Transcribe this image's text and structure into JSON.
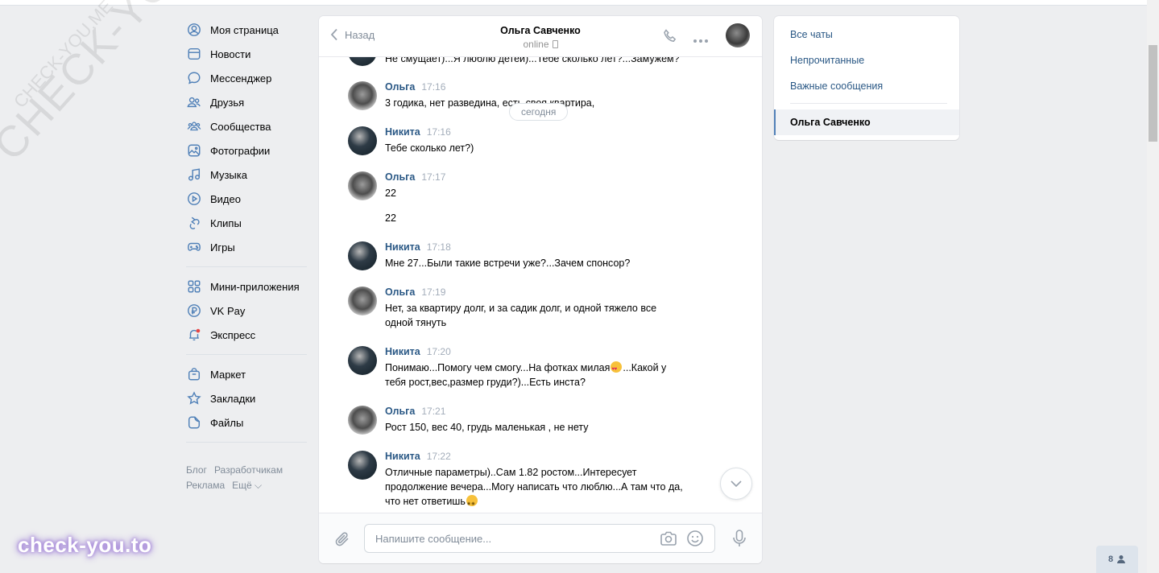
{
  "watermark": {
    "large": "CHECK-YOU.ME",
    "small": "CHECK-YOU.ME",
    "brand": "check-you.to"
  },
  "menu": {
    "items": [
      {
        "label": "Моя страница",
        "icon": "user-circle-icon"
      },
      {
        "label": "Новости",
        "icon": "news-icon"
      },
      {
        "label": "Мессенджер",
        "icon": "chat-bubble-icon"
      },
      {
        "label": "Друзья",
        "icon": "friends-icon"
      },
      {
        "label": "Сообщества",
        "icon": "communities-icon"
      },
      {
        "label": "Фотографии",
        "icon": "photo-icon"
      },
      {
        "label": "Музыка",
        "icon": "music-note-icon"
      },
      {
        "label": "Видео",
        "icon": "play-icon"
      },
      {
        "label": "Клипы",
        "icon": "clips-icon"
      },
      {
        "label": "Игры",
        "icon": "gamepad-icon"
      }
    ],
    "items2": [
      {
        "label": "Мини-приложения",
        "icon": "grid-icon"
      },
      {
        "label": "VK Pay",
        "icon": "ruble-icon"
      },
      {
        "label": "Экспресс",
        "icon": "bell-icon"
      }
    ],
    "items3": [
      {
        "label": "Маркет",
        "icon": "bag-icon"
      },
      {
        "label": "Закладки",
        "icon": "star-icon"
      },
      {
        "label": "Файлы",
        "icon": "file-icon"
      }
    ],
    "footer": [
      "Блог",
      "Разработчикам",
      "Реклама",
      "Ещё ⌵"
    ]
  },
  "chat": {
    "back_label": "Назад",
    "name": "Ольга Савченко",
    "status": "online",
    "date_pill": "сегодня",
    "partial_text": "Не смущает)...Я люблю детей)...Тебе сколько лет?...Замужем?",
    "messages": [
      {
        "author": "Ольга",
        "time": "17:16",
        "text": "3 годика, нет разведина, есть своя квартира,"
      },
      {
        "author": "Никита",
        "time": "17:16",
        "text": "Тебе сколько лет?)"
      },
      {
        "author": "Ольга",
        "time": "17:17",
        "text": "22",
        "text2": "22"
      },
      {
        "author": "Никита",
        "time": "17:18",
        "text": "Мне 27...Были такие встречи уже?...Зачем спонсор?"
      },
      {
        "author": "Ольга",
        "time": "17:19",
        "text": "Нет, за квартиру долг, и за садик долг, и одной тяжело все одной тянуть"
      },
      {
        "author": "Никита",
        "time": "17:20",
        "text_a": "Понимаю...Помогу чем смогу...На фотках милая",
        "text_b": "...Какой у тебя рост,вес,размер груди?)...Есть инста?"
      },
      {
        "author": "Ольга",
        "time": "17:21",
        "text": "Рост 150, вес 40, грудь маленькая , не нету"
      },
      {
        "author": "Никита",
        "time": "17:22",
        "text": "Отличные параметры)..Сам 1.82 ростом...Интересует продолжение вечера...Могу написать что люблю...А там что да, что нет ответишь"
      }
    ],
    "input_placeholder": "Напишите сообщение..."
  },
  "right_panel": {
    "all_chats": "Все чаты",
    "unread": "Непрочитанные",
    "important": "Важные сообщения",
    "active": "Ольга Савченко"
  },
  "online_count": "8"
}
